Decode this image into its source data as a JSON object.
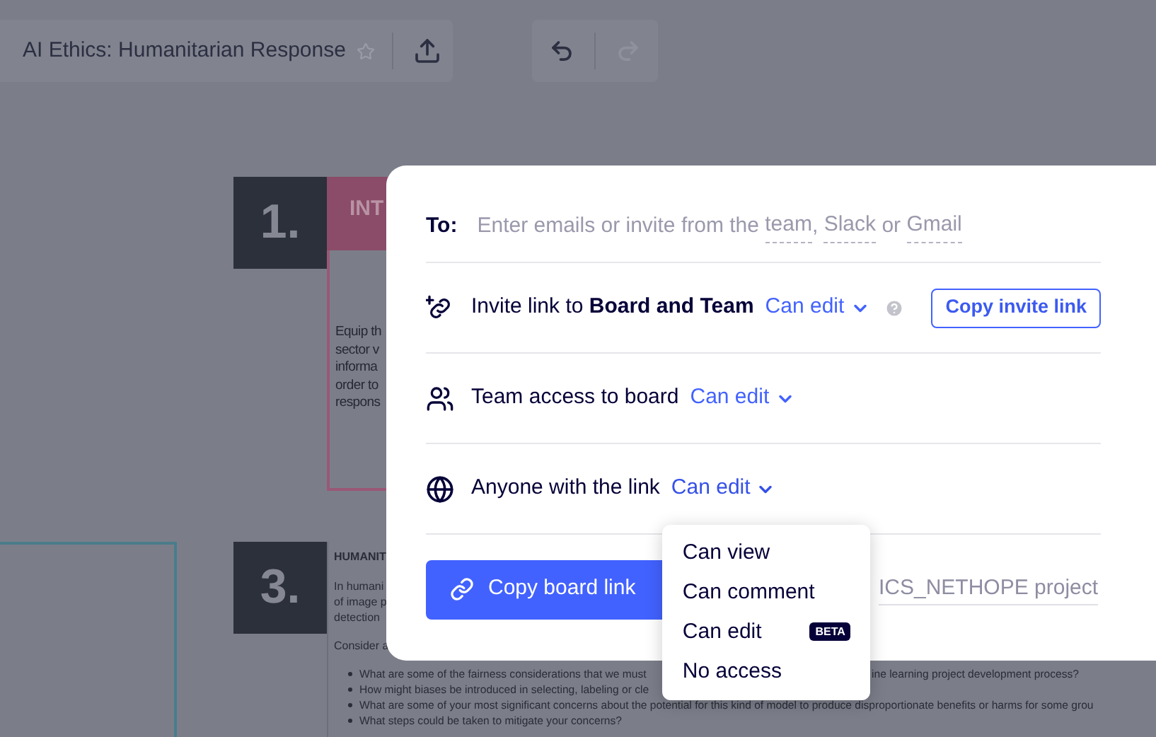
{
  "toolbar": {
    "title": "AI Ethics: Humanitarian Response",
    "starred": false
  },
  "history": {
    "undo_disabled": false,
    "redo_disabled": true
  },
  "board": {
    "card_1": {
      "number": "1.",
      "heading": "INT",
      "body": [
        "Equip th",
        "sector v",
        "informa",
        "order to",
        "respons"
      ]
    },
    "card_3": {
      "number": "3.",
      "heading": "HUMANIT",
      "intro": [
        "In humani",
        "of image p",
        "detection"
      ],
      "prompt": "Consider a",
      "bullets": [
        {
          "left": "What are some of the fairness considerations that we must",
          "right": "ine learning project development process?"
        },
        {
          "left": "How might biases be introduced in selecting, labeling or cle"
        },
        {
          "left": "What are some of your most significant concerns about the potential for this kind of model to produce disproportionate benefits or harms for some grou"
        },
        {
          "left": "What steps could be taken to mitigate your concerns?"
        }
      ]
    }
  },
  "share": {
    "to": {
      "label": "To:",
      "hint": [
        {
          "kind": "text",
          "text": "Enter emails or invite from the "
        },
        {
          "kind": "link",
          "text": "team"
        },
        {
          "kind": "text",
          "text": ", "
        },
        {
          "kind": "link",
          "text": "Slack"
        },
        {
          "kind": "text",
          "text": " or "
        },
        {
          "kind": "link",
          "text": "Gmail"
        }
      ]
    },
    "rows": [
      {
        "kind": "invite",
        "text": "Invite link to **Board and Team**",
        "permission": "Can edit",
        "help": true,
        "button": "Copy invite link",
        "expanded": false
      },
      {
        "kind": "team",
        "text": "Team access to board",
        "permission": "Can edit",
        "help": false,
        "expanded": false
      },
      {
        "kind": "anyone",
        "text": "Anyone with the link",
        "permission": "Can edit",
        "help": false,
        "expanded": true,
        "menu": [
          {
            "label": "Can view"
          },
          {
            "label": "Can comment"
          },
          {
            "label": "Can edit",
            "badge": "BETA"
          },
          {
            "label": "No access"
          }
        ]
      }
    ],
    "copy_button": "Copy board link",
    "project": "ICS_NETHOPE project"
  }
}
